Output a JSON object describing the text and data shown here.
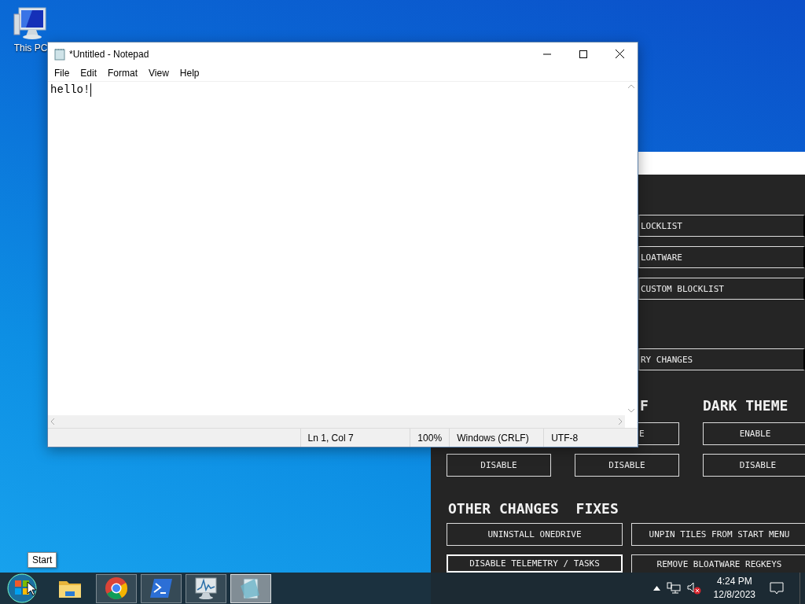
{
  "desktop": {
    "icons": [
      {
        "label": "This PC"
      }
    ]
  },
  "notepad": {
    "title": "*Untitled - Notepad",
    "menu": [
      "File",
      "Edit",
      "Format",
      "View",
      "Help"
    ],
    "text": "hello!",
    "status": [
      "Ln 1, Col 7",
      "100%",
      "Windows (CRLF)",
      "UTF-8"
    ]
  },
  "tool_window": {
    "top_groups": [
      [
        "LOCKLIST",
        "LOATWARE",
        "CUSTOM BLOCKLIST"
      ],
      [
        "RY CHANGES"
      ]
    ],
    "headings": [
      {
        "text": "F",
        "kind": "clipped"
      },
      {
        "text": "DARK THEME",
        "kind": "full"
      }
    ],
    "enable_buttons": [
      {
        "label": "E",
        "kind": "clipped"
      },
      {
        "label": "ENABLE",
        "kind": "full"
      }
    ],
    "disable_buttons": [
      "DISABLE",
      "DISABLE",
      "DISABLE"
    ],
    "section": "OTHER CHANGES  FIXES",
    "buttons": [
      {
        "label": "UNINSTALL ONEDRIVE",
        "focused": false
      },
      {
        "label": "UNPIN TILES FROM START MENU",
        "focused": false
      },
      {
        "label": "DISABLE TELEMETRY / TASKS",
        "focused": true
      },
      {
        "label": "REMOVE BLOATWARE REGKEYS",
        "focused": false
      }
    ]
  },
  "tooltip": "Start",
  "taskbar": {
    "apps": [
      {
        "kind": "start",
        "running": false,
        "selected": false
      },
      {
        "kind": "explorer",
        "running": false,
        "selected": false
      },
      {
        "kind": "chrome",
        "running": true,
        "selected": false
      },
      {
        "kind": "powershell",
        "running": true,
        "selected": false
      },
      {
        "kind": "monitor",
        "running": true,
        "selected": false
      },
      {
        "kind": "notepad",
        "running": true,
        "selected": true
      }
    ],
    "tray": {
      "time": "4:24 PM",
      "date": "12/8/2023"
    }
  }
}
